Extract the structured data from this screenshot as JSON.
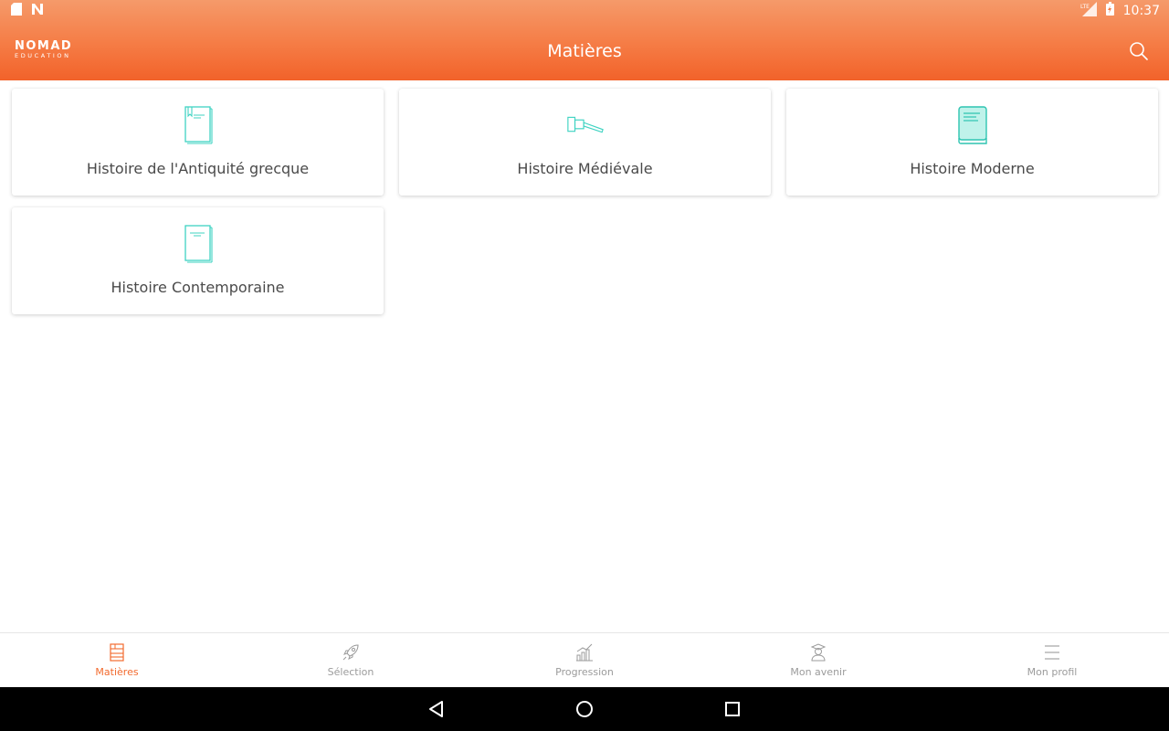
{
  "status_bar": {
    "time": "10:37",
    "icons": [
      "sd-card-icon",
      "n-notification-icon",
      "lte-signal-icon",
      "battery-charging-icon"
    ]
  },
  "header": {
    "logo_main": "NOMAD",
    "logo_sub": "EDUCATION",
    "title": "Matières",
    "search_icon": "search-icon"
  },
  "subjects": [
    {
      "label": "Histoire de l'Antiquité grecque",
      "icon": "bookmarked-book-icon"
    },
    {
      "label": "Histoire Médiévale",
      "icon": "gavel-icon"
    },
    {
      "label": "Histoire Moderne",
      "icon": "closed-book-icon"
    },
    {
      "label": "Histoire Contemporaine",
      "icon": "document-pages-icon"
    }
  ],
  "bottom_nav": [
    {
      "label": "Matières",
      "icon": "bookshelf-icon",
      "active": true
    },
    {
      "label": "Sélection",
      "icon": "rocket-icon",
      "active": false
    },
    {
      "label": "Progression",
      "icon": "bar-chart-icon",
      "active": false
    },
    {
      "label": "Mon avenir",
      "icon": "graduate-icon",
      "active": false
    },
    {
      "label": "Mon profil",
      "icon": "menu-lines-icon",
      "active": false
    }
  ],
  "system_nav": [
    "back-icon",
    "home-icon",
    "recents-icon"
  ],
  "colors": {
    "accent": "#f26a2e",
    "icon_teal": "#3fd3c2",
    "inactive": "#9b9b9b"
  }
}
